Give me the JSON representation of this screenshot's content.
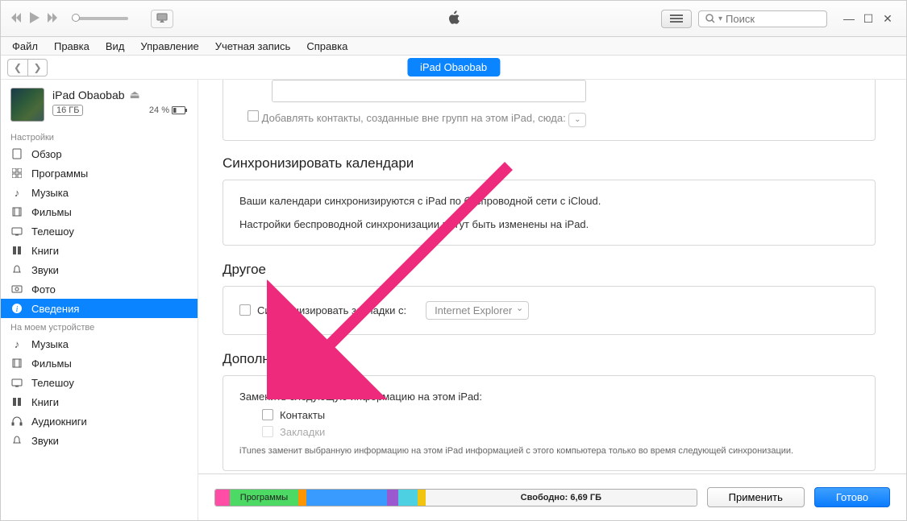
{
  "toolbar": {
    "search_placeholder": "Поиск"
  },
  "menubar": [
    "Файл",
    "Правка",
    "Вид",
    "Управление",
    "Учетная запись",
    "Справка"
  ],
  "device_pill": "iPad Obaobab",
  "device": {
    "name": "iPad Obaobab",
    "capacity": "16 ГБ",
    "battery": "24 %"
  },
  "sidebar": {
    "settings_label": "Настройки",
    "settings": [
      {
        "label": "Обзор"
      },
      {
        "label": "Программы"
      },
      {
        "label": "Музыка"
      },
      {
        "label": "Фильмы"
      },
      {
        "label": "Телешоу"
      },
      {
        "label": "Книги"
      },
      {
        "label": "Звуки"
      },
      {
        "label": "Фото"
      },
      {
        "label": "Сведения"
      }
    ],
    "ondevice_label": "На моем устройстве",
    "ondevice": [
      {
        "label": "Музыка"
      },
      {
        "label": "Фильмы"
      },
      {
        "label": "Телешоу"
      },
      {
        "label": "Книги"
      },
      {
        "label": "Аудиокниги"
      },
      {
        "label": "Звуки"
      }
    ]
  },
  "content": {
    "add_contacts_label": "Добавлять контакты, созданные вне групп на этом iPad, сюда:",
    "cal_header": "Синхронизировать календари",
    "cal_line1": "Ваши календари синхронизируются с iPad по беспроводной сети с iCloud.",
    "cal_line2": "Настройки беспроводной синхронизации могут быть изменены на iPad.",
    "other_header": "Другое",
    "other_sync_label": "Синхронизировать закладки с:",
    "other_select": "Internet Explorer",
    "addons_header": "Дополнения",
    "addons_replace_label": "Заменить следующую информацию на этом iPad:",
    "addons_contacts": "Контакты",
    "addons_bookmarks": "Закладки",
    "addons_note": "iTunes заменит выбранную информацию на этом iPad информацией с этого компьютера только во время следующей синхронизации."
  },
  "bottom": {
    "apps_label": "Программы",
    "free_label": "Свободно: 6,69 ГБ",
    "apply": "Применить",
    "done": "Готово"
  }
}
